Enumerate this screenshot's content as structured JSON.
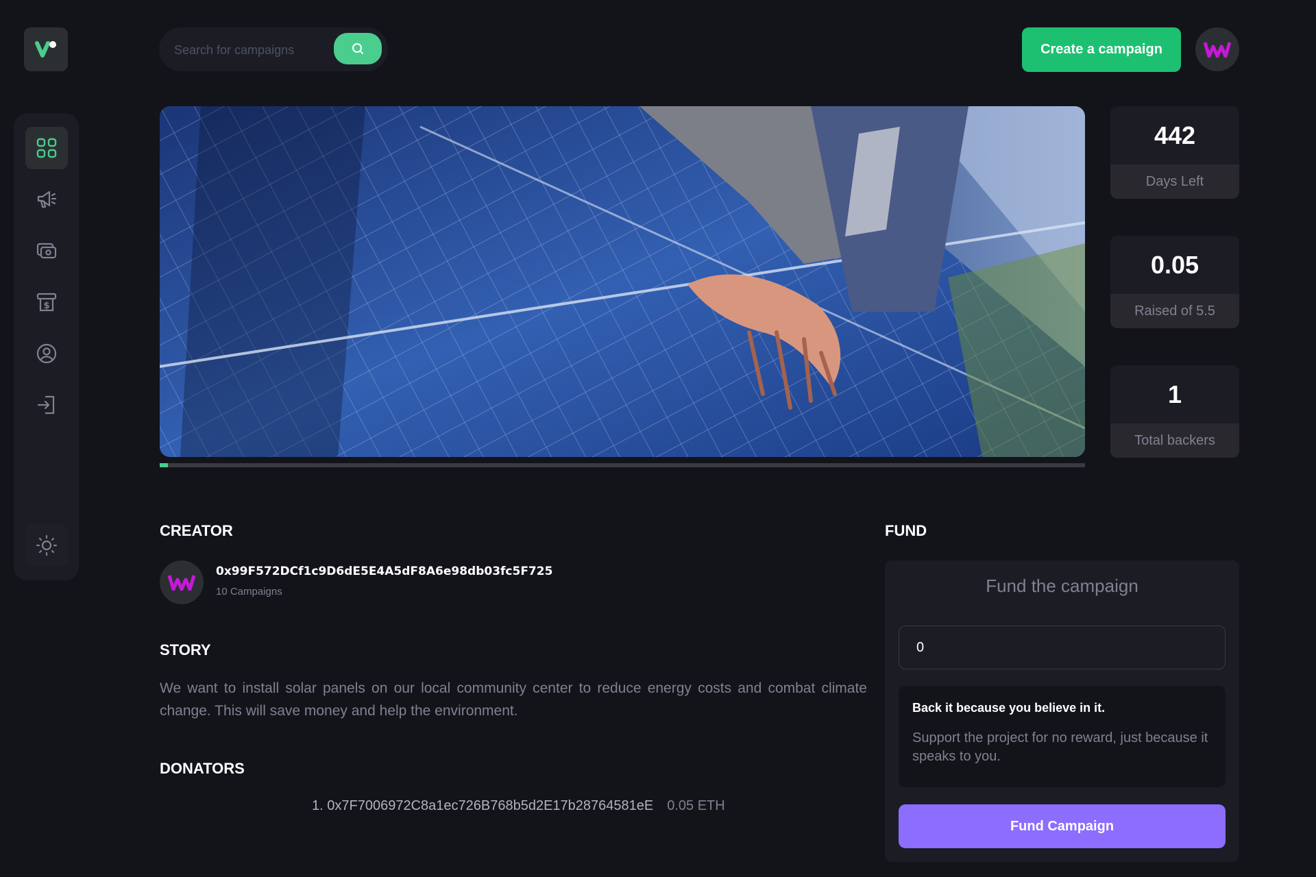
{
  "search": {
    "placeholder": "Search for campaigns"
  },
  "header": {
    "create_label": "Create a campaign"
  },
  "sidebar": {
    "items": [
      {
        "name": "dashboard",
        "icon": "dashboard-icon",
        "active": true
      },
      {
        "name": "campaign",
        "icon": "megaphone-icon",
        "active": false
      },
      {
        "name": "payment",
        "icon": "payment-icon",
        "active": false
      },
      {
        "name": "withdraw",
        "icon": "withdraw-icon",
        "active": false
      },
      {
        "name": "profile",
        "icon": "profile-icon",
        "active": false
      },
      {
        "name": "logout",
        "icon": "logout-icon",
        "active": false
      }
    ],
    "theme_icon": "sun-icon"
  },
  "campaign": {
    "progress_fraction": 0.009,
    "stats": [
      {
        "value": "442",
        "label": "Days Left"
      },
      {
        "value": "0.05",
        "label": "Raised of 5.5"
      },
      {
        "value": "1",
        "label": "Total backers"
      }
    ]
  },
  "creator": {
    "heading": "Creator",
    "address": "0x99F572DCf1c9D6dE5E4A5dF8A6e98db03fc5F725",
    "campaigns": "10 Campaigns"
  },
  "story": {
    "heading": "Story",
    "text": "We want to install solar panels on our local community center to reduce energy costs and combat climate change. This will save money and help the environment."
  },
  "donators": {
    "heading": "Donators",
    "list": [
      {
        "label": "1. 0x7F7006972C8a1ec726B768b5d2E17b28764581eE",
        "amount": "0.05 ETH"
      }
    ]
  },
  "fund": {
    "heading": "Fund",
    "title": "Fund the campaign",
    "input_value": "0",
    "note_title": "Back it because you believe in it.",
    "note_text": "Support the project for no reward, just because it speaks to you.",
    "button_label": "Fund Campaign"
  },
  "colors": {
    "background": "#13131a",
    "panel": "#1c1c24",
    "accent_green": "#1dc071",
    "accent_purple": "#8c6dfd",
    "muted_text": "#808191"
  }
}
